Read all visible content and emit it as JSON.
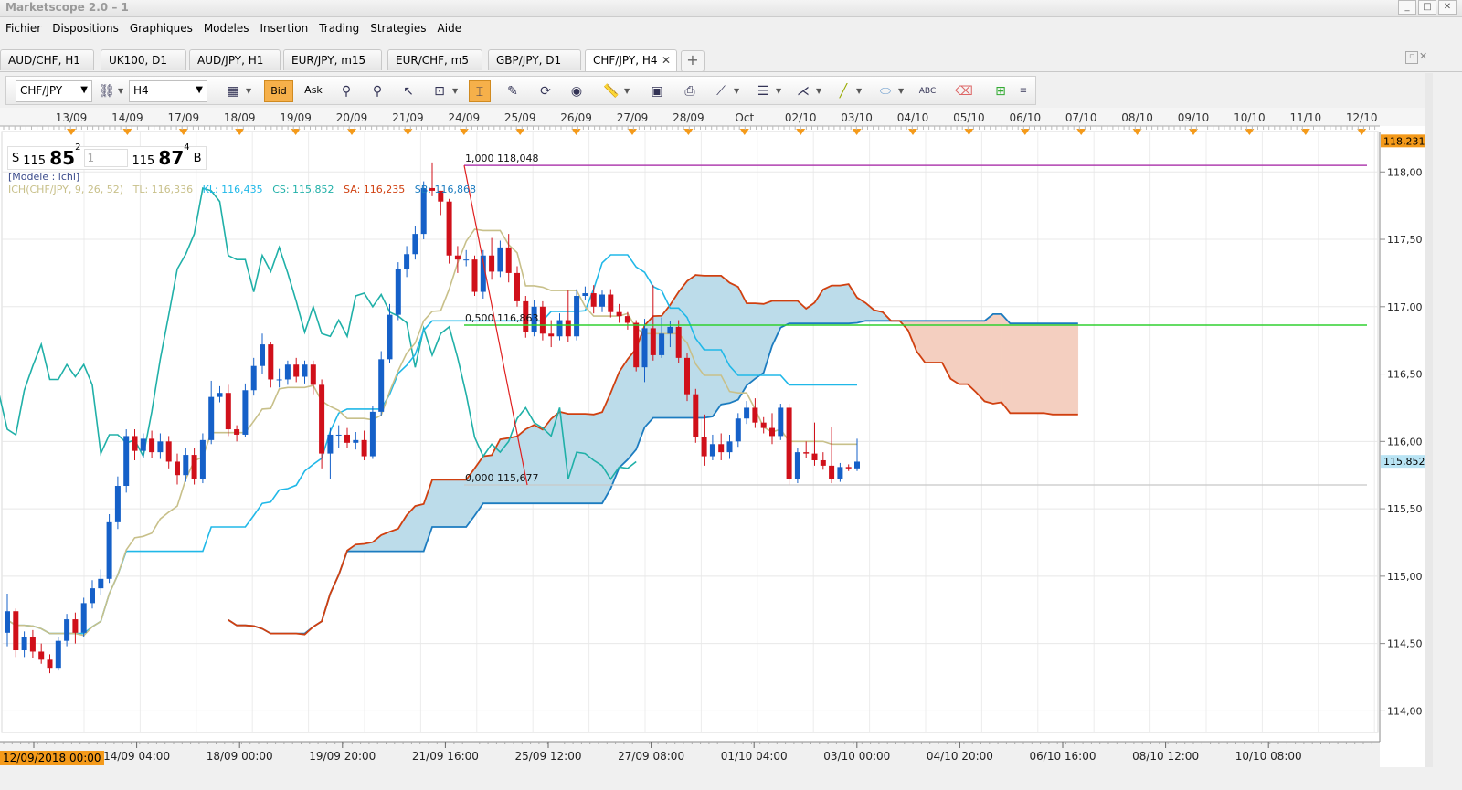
{
  "window": {
    "title": "Marketscope 2.0 – 1"
  },
  "menu": [
    "Fichier",
    "Dispositions",
    "Graphiques",
    "Modeles",
    "Insertion",
    "Trading",
    "Strategies",
    "Aide"
  ],
  "tabs": [
    {
      "label": "AUD/CHF, H1"
    },
    {
      "label": "UK100, D1"
    },
    {
      "label": "AUD/JPY, H1"
    },
    {
      "label": "EUR/JPY, m15"
    },
    {
      "label": "EUR/CHF, m5"
    },
    {
      "label": "GBP/JPY, D1"
    },
    {
      "label": "CHF/JPY, H4",
      "active": true
    }
  ],
  "tab_add": "+",
  "toolbar": {
    "symbol": "CHF/JPY",
    "timeframe": "H4",
    "bid_label": "Bid",
    "ask_label": "Ask"
  },
  "quote": {
    "sell_label": "S",
    "sell_big_prefix": "115",
    "sell_big": "85",
    "sell_pip": "2",
    "amount": "1",
    "buy_big_prefix": "115",
    "buy_big": "87",
    "buy_pip": "4",
    "buy_label": "B"
  },
  "model_label": "[Modele : ichi]",
  "ichimoku_legend": {
    "name": "ICH(CHF/JPY, 9, 26, 52)",
    "tl": "TL: 116,336",
    "kl": "KL: 116,435",
    "cs": "CS: 115,852",
    "sa": "SA: 116,235",
    "sb": "SB: 116,868"
  },
  "colors": {
    "bull": "#1560c8",
    "bear": "#d0101a",
    "tenkan": "#c8c08a",
    "kijun": "#20b8e8",
    "chikou": "#20b0a8",
    "senkou_a": "#d04010",
    "senkou_b": "#1c7cc0",
    "cloud_bull": "#bcdcea",
    "cloud_bear": "#f4cfc0",
    "fibo": "#b040b0",
    "hline": "#30d030"
  },
  "chart_data": {
    "type": "candlestick",
    "symbol": "CHF/JPY",
    "timeframe": "H4",
    "ylim": [
      113.84,
      118.3
    ],
    "y_ticks": [
      "114,00",
      "114,50",
      "115,00",
      "115,50",
      "116,00",
      "116,50",
      "117,00",
      "117,50",
      "118,00"
    ],
    "y_tick_values": [
      114.0,
      114.5,
      115.0,
      115.5,
      116.0,
      116.5,
      117.0,
      117.5,
      118.0
    ],
    "top_dates": [
      "13/09",
      "14/09",
      "17/09",
      "18/09",
      "19/09",
      "20/09",
      "21/09",
      "24/09",
      "25/09",
      "26/09",
      "27/09",
      "28/09",
      "Oct",
      "02/10",
      "03/10",
      "04/10",
      "05/10",
      "06/10",
      "07/10",
      "08/10",
      "09/10",
      "10/10",
      "11/10",
      "12/10"
    ],
    "bottom_dates": [
      "12/09/2018 00:00",
      "14/09 04:00",
      "18/09 00:00",
      "19/09 20:00",
      "21/09 16:00",
      "25/09 12:00",
      "27/09 08:00",
      "01/10 04:00",
      "03/10 00:00",
      "04/10 20:00",
      "06/10 16:00",
      "08/10 12:00",
      "10/10 08:00"
    ],
    "last_price_label": "115,852",
    "high_label": "118,231",
    "last_price": 115.852,
    "fibo_level": 116.863,
    "fibonacci": [
      {
        "label": "1,000 118,048",
        "value": 118.048
      },
      {
        "label": "0,500 116,863",
        "value": 116.863
      },
      {
        "label": "0,000 115,677",
        "value": 115.677
      }
    ],
    "candles": [
      [
        114.58,
        114.74,
        114.87,
        114.48
      ],
      [
        114.74,
        114.45,
        114.76,
        114.4
      ],
      [
        114.45,
        114.55,
        114.59,
        114.4
      ],
      [
        114.55,
        114.44,
        114.6,
        114.39
      ],
      [
        114.44,
        114.38,
        114.5,
        114.35
      ],
      [
        114.38,
        114.32,
        114.42,
        114.28
      ],
      [
        114.32,
        114.52,
        114.55,
        114.3
      ],
      [
        114.52,
        114.68,
        114.72,
        114.48
      ],
      [
        114.68,
        114.58,
        114.73,
        114.5
      ],
      [
        114.58,
        114.8,
        114.84,
        114.55
      ],
      [
        114.8,
        114.91,
        114.97,
        114.76
      ],
      [
        114.91,
        114.98,
        115.05,
        114.86
      ],
      [
        114.98,
        115.4,
        115.46,
        114.95
      ],
      [
        115.4,
        115.67,
        115.74,
        115.35
      ],
      [
        115.67,
        116.04,
        116.09,
        115.62
      ],
      [
        116.04,
        115.93,
        116.09,
        115.86
      ],
      [
        115.93,
        116.02,
        116.06,
        115.88
      ],
      [
        116.02,
        115.92,
        116.08,
        115.88
      ],
      [
        115.92,
        116.0,
        116.06,
        115.87
      ],
      [
        116.0,
        115.85,
        116.04,
        115.8
      ],
      [
        115.85,
        115.75,
        115.91,
        115.68
      ],
      [
        115.75,
        115.9,
        115.95,
        115.7
      ],
      [
        115.9,
        115.72,
        115.95,
        115.68
      ],
      [
        115.72,
        116.01,
        116.06,
        115.69
      ],
      [
        116.01,
        116.33,
        116.45,
        115.98
      ],
      [
        116.33,
        116.36,
        116.41,
        116.29
      ],
      [
        116.36,
        116.09,
        116.42,
        116.04
      ],
      [
        116.09,
        116.05,
        116.12,
        116.0
      ],
      [
        116.05,
        116.38,
        116.43,
        116.03
      ],
      [
        116.38,
        116.56,
        116.62,
        116.34
      ],
      [
        116.56,
        116.72,
        116.8,
        116.5
      ],
      [
        116.72,
        116.46,
        116.74,
        116.4
      ],
      [
        116.46,
        116.46,
        116.54,
        116.4
      ],
      [
        116.46,
        116.57,
        116.6,
        116.42
      ],
      [
        116.57,
        116.48,
        116.62,
        116.44
      ],
      [
        116.48,
        116.57,
        116.6,
        116.43
      ],
      [
        116.57,
        116.42,
        116.6,
        116.35
      ],
      [
        116.42,
        115.91,
        116.46,
        115.8
      ],
      [
        115.91,
        116.05,
        116.1,
        115.72
      ],
      [
        116.05,
        116.05,
        116.12,
        115.95
      ],
      [
        116.05,
        115.99,
        116.1,
        115.95
      ],
      [
        115.99,
        116.01,
        116.07,
        115.94
      ],
      [
        116.01,
        115.89,
        116.08,
        115.86
      ],
      [
        115.89,
        116.22,
        116.26,
        115.87
      ],
      [
        116.22,
        116.61,
        116.67,
        116.19
      ],
      [
        116.61,
        116.94,
        117.02,
        116.58
      ],
      [
        116.94,
        117.28,
        117.33,
        116.9
      ],
      [
        117.28,
        117.39,
        117.45,
        117.22
      ],
      [
        117.39,
        117.54,
        117.6,
        117.35
      ],
      [
        117.54,
        117.88,
        117.93,
        117.5
      ],
      [
        117.88,
        117.86,
        118.07,
        117.82
      ],
      [
        117.86,
        117.78,
        117.86,
        117.68
      ],
      [
        117.78,
        117.38,
        117.8,
        117.32
      ],
      [
        117.38,
        117.35,
        117.45,
        117.25
      ],
      [
        117.35,
        117.35,
        117.42,
        117.3
      ],
      [
        117.35,
        117.11,
        117.38,
        117.08
      ],
      [
        117.11,
        117.38,
        117.42,
        117.06
      ],
      [
        117.38,
        117.26,
        117.51,
        117.2
      ],
      [
        117.26,
        117.44,
        117.49,
        117.22
      ],
      [
        117.44,
        117.25,
        117.54,
        117.18
      ],
      [
        117.25,
        117.04,
        117.3,
        117.0
      ],
      [
        117.04,
        116.81,
        117.08,
        116.77
      ],
      [
        116.81,
        117.0,
        117.05,
        116.78
      ],
      [
        117.0,
        116.8,
        117.04,
        116.75
      ],
      [
        116.8,
        116.78,
        116.9,
        116.7
      ],
      [
        116.78,
        116.9,
        116.95,
        116.75
      ],
      [
        116.9,
        116.78,
        117.12,
        116.74
      ],
      [
        116.78,
        117.08,
        117.13,
        116.75
      ],
      [
        117.08,
        117.1,
        117.15,
        117.05
      ],
      [
        117.1,
        117.0,
        117.16,
        116.95
      ],
      [
        117.0,
        117.09,
        117.12,
        116.96
      ],
      [
        117.09,
        116.96,
        117.13,
        116.92
      ],
      [
        116.96,
        116.93,
        117.02,
        116.88
      ],
      [
        116.93,
        116.88,
        116.96,
        116.83
      ],
      [
        116.88,
        116.55,
        116.9,
        116.52
      ],
      [
        116.55,
        116.84,
        116.91,
        116.44
      ],
      [
        116.84,
        116.64,
        117.16,
        116.6
      ],
      [
        116.64,
        116.8,
        116.92,
        116.62
      ],
      [
        116.8,
        116.85,
        116.89,
        116.7
      ],
      [
        116.85,
        116.62,
        116.9,
        116.58
      ],
      [
        116.62,
        116.35,
        116.66,
        116.3
      ],
      [
        116.35,
        116.03,
        116.39,
        115.99
      ],
      [
        116.03,
        115.89,
        116.2,
        115.82
      ],
      [
        115.89,
        115.98,
        116.05,
        115.86
      ],
      [
        115.98,
        115.92,
        116.06,
        115.86
      ],
      [
        115.92,
        116.0,
        116.05,
        115.87
      ],
      [
        116.0,
        116.17,
        116.21,
        115.96
      ],
      [
        116.17,
        116.25,
        116.3,
        116.13
      ],
      [
        116.25,
        116.14,
        116.32,
        116.1
      ],
      [
        116.14,
        116.1,
        116.18,
        116.06
      ],
      [
        116.1,
        116.04,
        116.21,
        115.98
      ],
      [
        116.04,
        116.25,
        116.28,
        116.01
      ],
      [
        116.25,
        115.72,
        116.28,
        115.68
      ],
      [
        115.72,
        115.92,
        115.95,
        115.69
      ],
      [
        115.92,
        115.91,
        116.0,
        115.88
      ],
      [
        115.91,
        115.86,
        116.14,
        115.82
      ],
      [
        115.86,
        115.82,
        115.92,
        115.79
      ],
      [
        115.82,
        115.72,
        116.11,
        115.69
      ],
      [
        115.72,
        115.81,
        115.84,
        115.7
      ],
      [
        115.81,
        115.8,
        115.83,
        115.78
      ],
      [
        115.8,
        115.85,
        116.02,
        115.78
      ]
    ]
  }
}
